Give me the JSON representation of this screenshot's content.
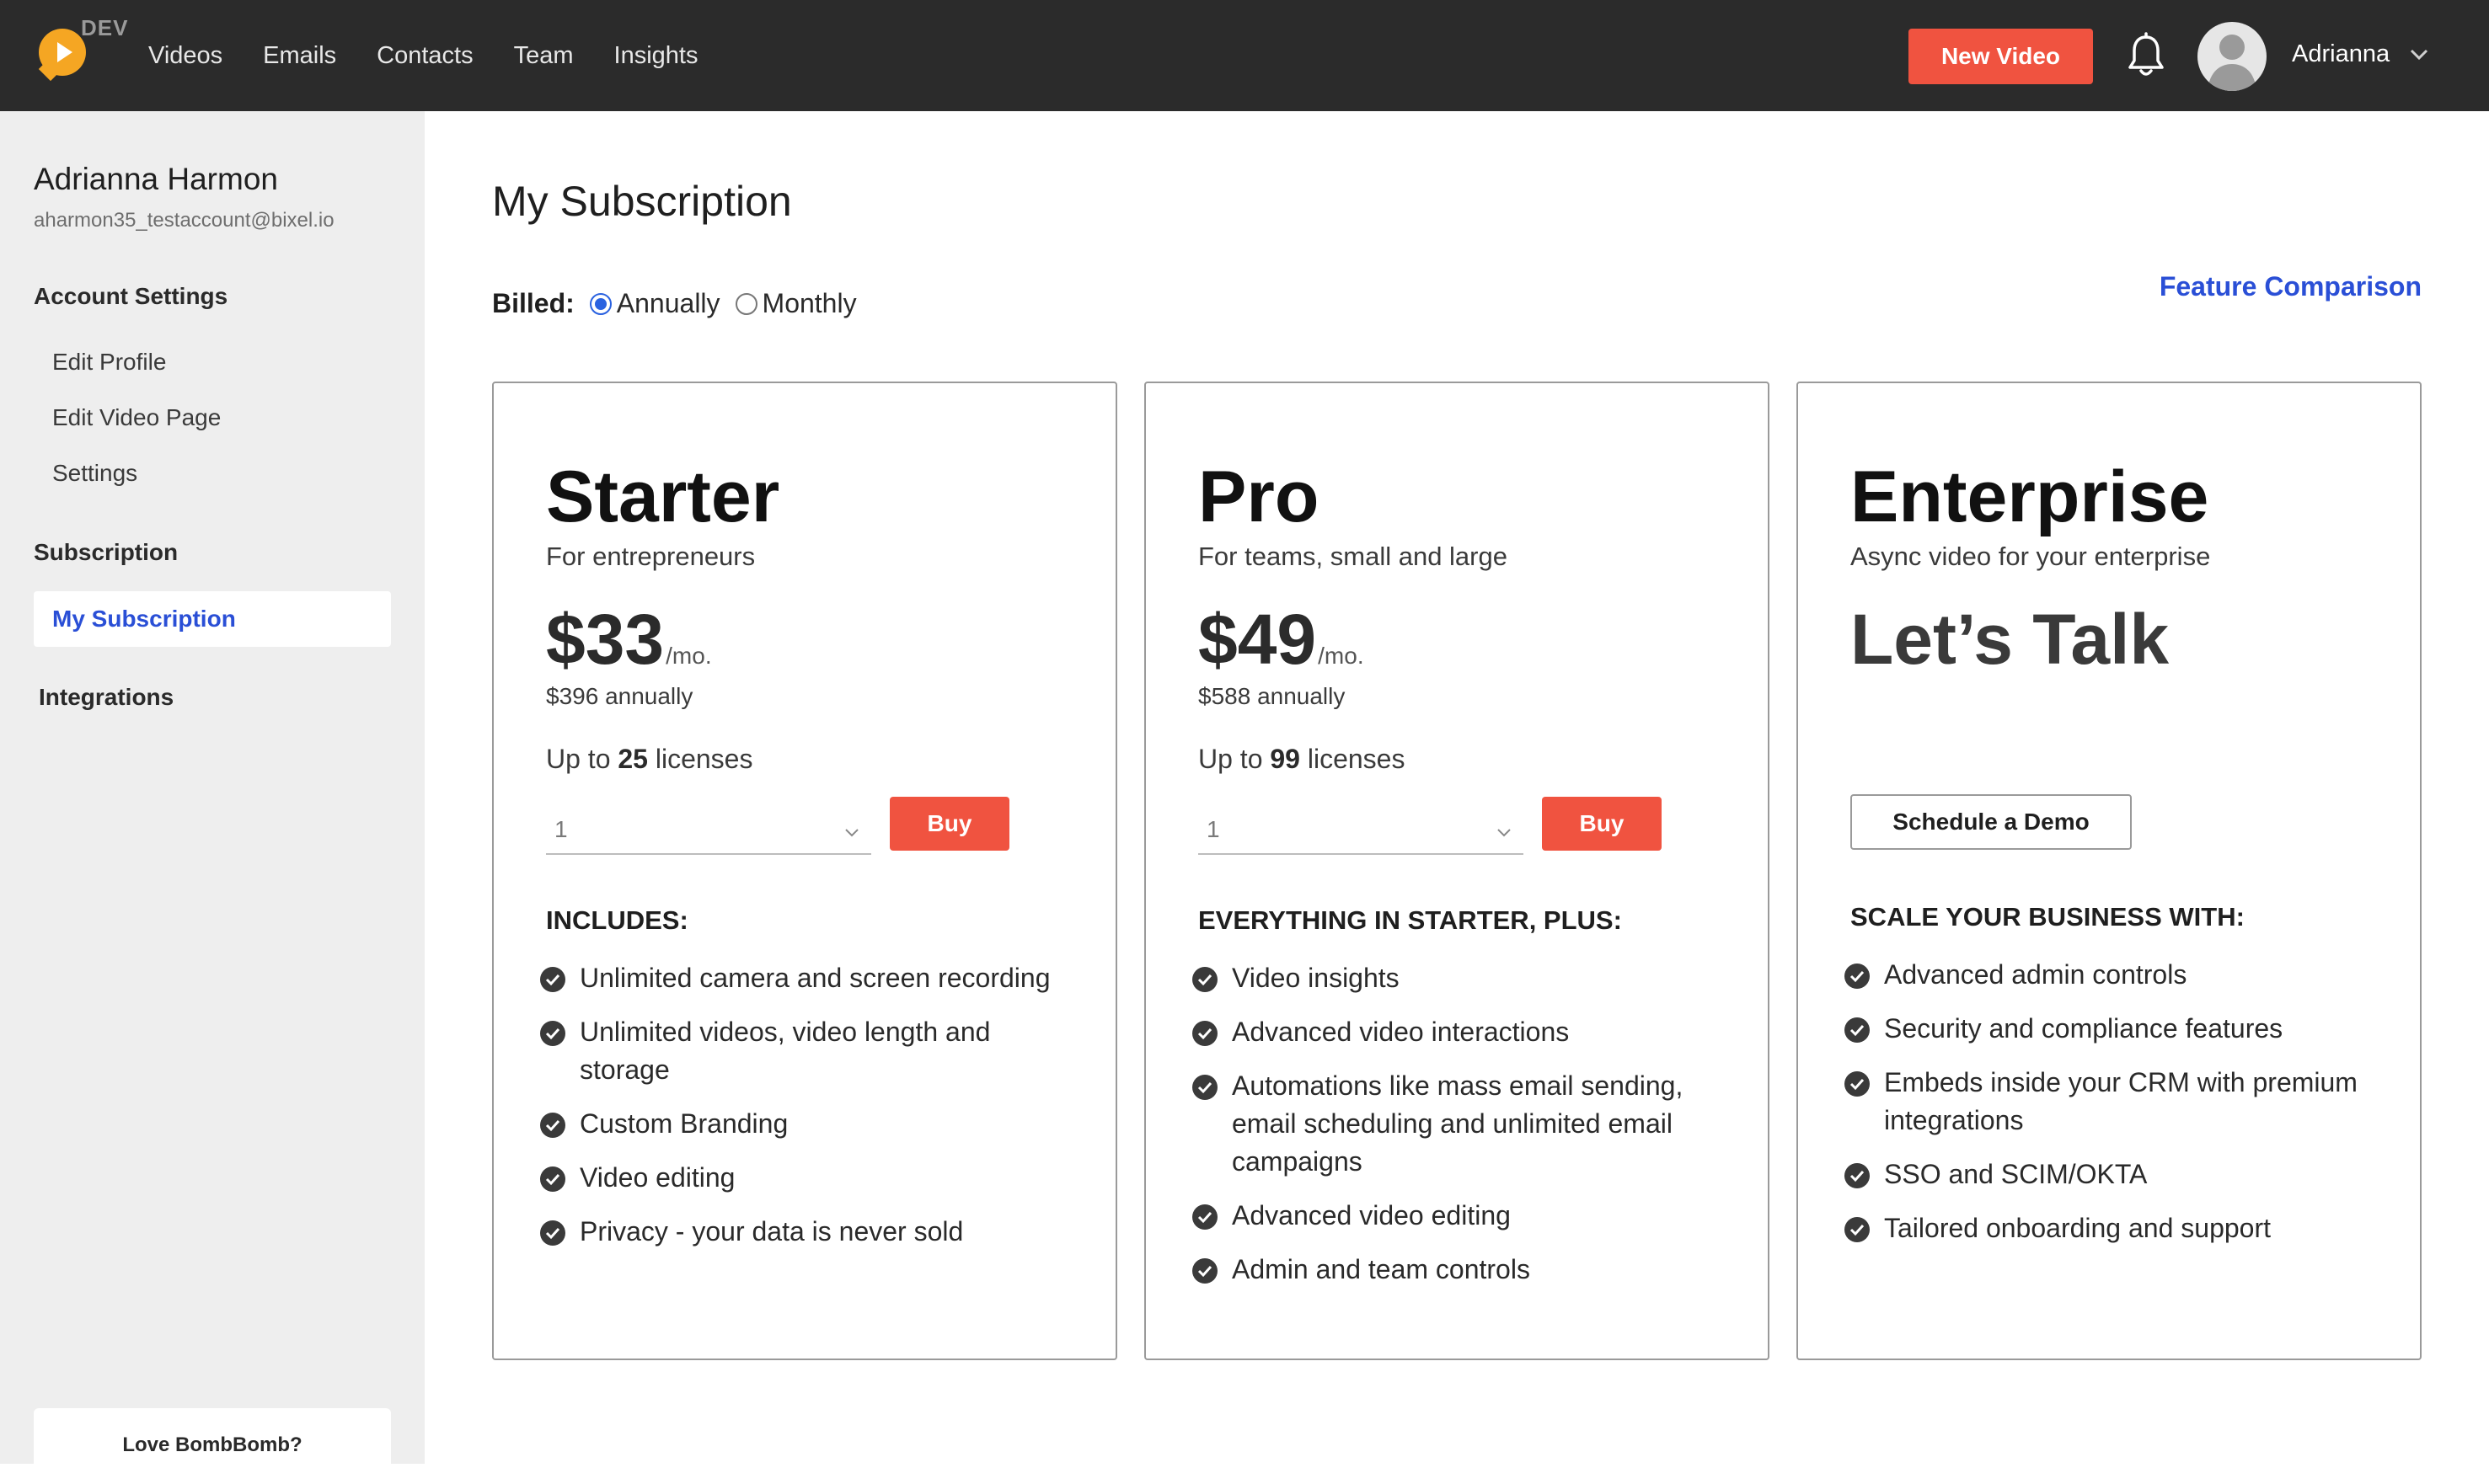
{
  "nav": {
    "env_tag": "DEV",
    "links": [
      "Videos",
      "Emails",
      "Contacts",
      "Team",
      "Insights"
    ],
    "new_video_label": "New Video",
    "user_name": "Adrianna"
  },
  "sidebar": {
    "name": "Adrianna Harmon",
    "email": "aharmon35_testaccount@bixel.io",
    "account_settings": "Account Settings",
    "items": [
      "Edit Profile",
      "Edit Video Page",
      "Settings"
    ],
    "subscription": "Subscription",
    "my_subscription": "My Subscription",
    "integrations": "Integrations",
    "love": "Love BombBomb?"
  },
  "main": {
    "title": "My Subscription",
    "billed_label": "Billed:",
    "billing_options": [
      "Annually",
      "Monthly"
    ],
    "selected_billing": "Annually",
    "feature_comparison": "Feature Comparison"
  },
  "plans": [
    {
      "name": "Starter",
      "subtitle": "For entrepreneurs",
      "price": "$33",
      "per": "/mo.",
      "annual": "$396 annually",
      "licenses_prefix": "Up to ",
      "licenses_count": "25",
      "licenses_suffix": " licenses",
      "quantity": "1",
      "buy_label": "Buy",
      "features_heading": "INCLUDES:",
      "features": [
        "Unlimited camera and screen recording",
        "Unlimited videos, video length and storage",
        "Custom Branding",
        "Video editing",
        "Privacy - your data is never sold"
      ]
    },
    {
      "name": "Pro",
      "subtitle": "For teams, small and large",
      "price": "$49",
      "per": "/mo.",
      "annual": "$588 annually",
      "licenses_prefix": "Up to ",
      "licenses_count": "99",
      "licenses_suffix": " licenses",
      "quantity": "1",
      "buy_label": "Buy",
      "features_heading": "EVERYTHING IN STARTER, PLUS:",
      "features": [
        "Video insights",
        "Advanced video interactions",
        "Automations like mass email sending, email scheduling and unlimited email campaigns",
        "Advanced video editing",
        "Admin and team controls"
      ]
    },
    {
      "name": "Enterprise",
      "subtitle": "Async video for your enterprise",
      "headline": "Let’s Talk",
      "demo_label": "Schedule a Demo",
      "features_heading": "SCALE YOUR BUSINESS WITH:",
      "features": [
        "Advanced admin controls",
        "Security and compliance features",
        "Embeds inside your CRM with premium integrations",
        "SSO and SCIM/OKTA",
        "Tailored onboarding and support"
      ]
    }
  ],
  "colors": {
    "nav_bg": "#2b2b2b",
    "accent_red": "#f05340",
    "link_blue": "#2a4fd6",
    "sidebar_bg": "#eeeeee",
    "logo_orange": "#f5a623"
  }
}
